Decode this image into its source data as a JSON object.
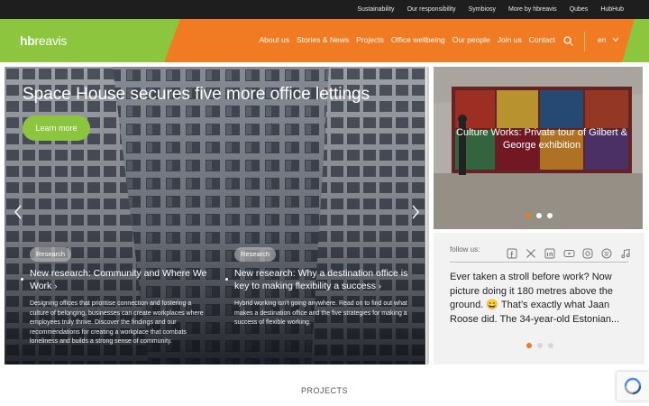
{
  "topbar": {
    "links": [
      "Sustainability",
      "Our responsibility",
      "Symbiosy",
      "More by hbreavis",
      "Qubes",
      "HubHub"
    ]
  },
  "header": {
    "logo_bold": "hb",
    "logo_rest": "reavis",
    "nav": [
      "About us",
      "Stories & News",
      "Projects",
      "Office wellbeing",
      "Our people",
      "Join us",
      "Contact"
    ],
    "language": "en",
    "icons": {
      "search": "search-icon",
      "language": "chevron-down-icon"
    }
  },
  "hero": {
    "title": "Space House secures five more office lettings",
    "button": "Learn more",
    "news": [
      {
        "tag": "Research",
        "title": "New research: Community and Where We Work",
        "desc": "Designing offices that prioritise connection and fostering a culture of belonging, businesses can create workplaces where employees truly thrive. Discover the findings and our recommendations for creating a workplace that combats loneliness and builds a strong sense of community."
      },
      {
        "tag": "Research",
        "title": "New research: Why a destination office is key to making flexibility a success",
        "desc": "Hybrid working isn’t going anywhere. Read on to find out what makes a destination office and the five strategies for making a success of flexible working."
      }
    ]
  },
  "culture": {
    "title": "Culture Works: Private tour of Gilbert & George exhibition",
    "dots": 3,
    "active_dot": 0
  },
  "social": {
    "follow_label": "follow us:",
    "icons": [
      "facebook-icon",
      "x-icon",
      "linkedin-icon",
      "youtube-icon",
      "instagram-icon",
      "spotify-icon",
      "music-icon"
    ],
    "post": "Ever taken a stroll before work? Now picture doing it 180 metres above the ground. 😄 That’s exactly what Jaan Roose did. The 34-year-old Estonian...",
    "dots": 3,
    "active_dot": 0
  },
  "section_title": "PROJECTS",
  "colors": {
    "orange": "#f07b22",
    "green": "#8cc63f",
    "topbar": "#1e1e1e"
  }
}
